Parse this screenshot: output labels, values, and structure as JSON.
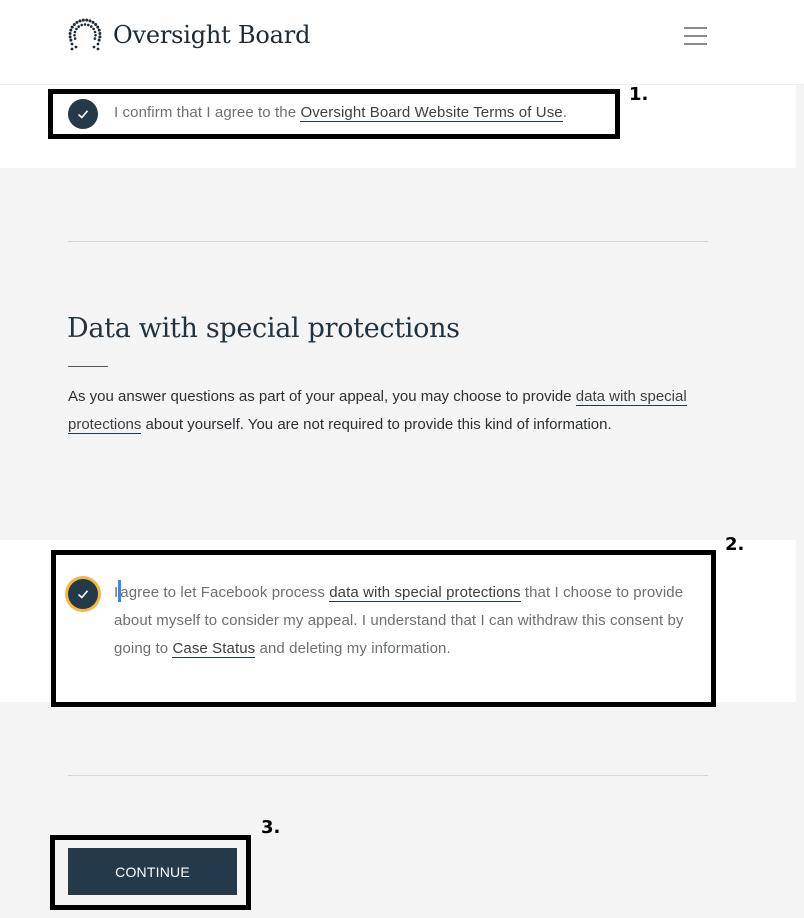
{
  "header": {
    "logo_text": "Oversight Board",
    "logo_icon": "dotted-horseshoe-logo-icon",
    "menu_icon": "hamburger-menu-icon"
  },
  "terms_consent": {
    "checked": true,
    "text_before": "I confirm that I agree to the ",
    "link_text": "Oversight Board Website Terms of Use",
    "text_after": "."
  },
  "special_data_section": {
    "title": "Data with special protections",
    "para_before": "As you answer questions as part of your appeal, you may choose to provide ",
    "para_link": "data with special protections",
    "para_after": " about yourself. You are not required to provide this kind of information."
  },
  "special_data_consent": {
    "checked": true,
    "focused": true,
    "text_first_char": "I",
    "text_part1": "agree to let Facebook process ",
    "link1_text": "data with special protections",
    "text_part2": " that I choose to provide about myself to consider my appeal. I understand that I can withdraw this consent by going to ",
    "link2_text": "Case Status",
    "text_part3": " and deleting my information."
  },
  "actions": {
    "continue_label": "CONTINUE"
  },
  "annotations": {
    "label_1": "1.",
    "label_2": "2.",
    "label_3": "3."
  },
  "colors": {
    "brand_navy": "#24394a",
    "focus_ring": "#f4b73f",
    "page_bg": "#f4f4f4",
    "caret_blue": "#3a86f0"
  }
}
